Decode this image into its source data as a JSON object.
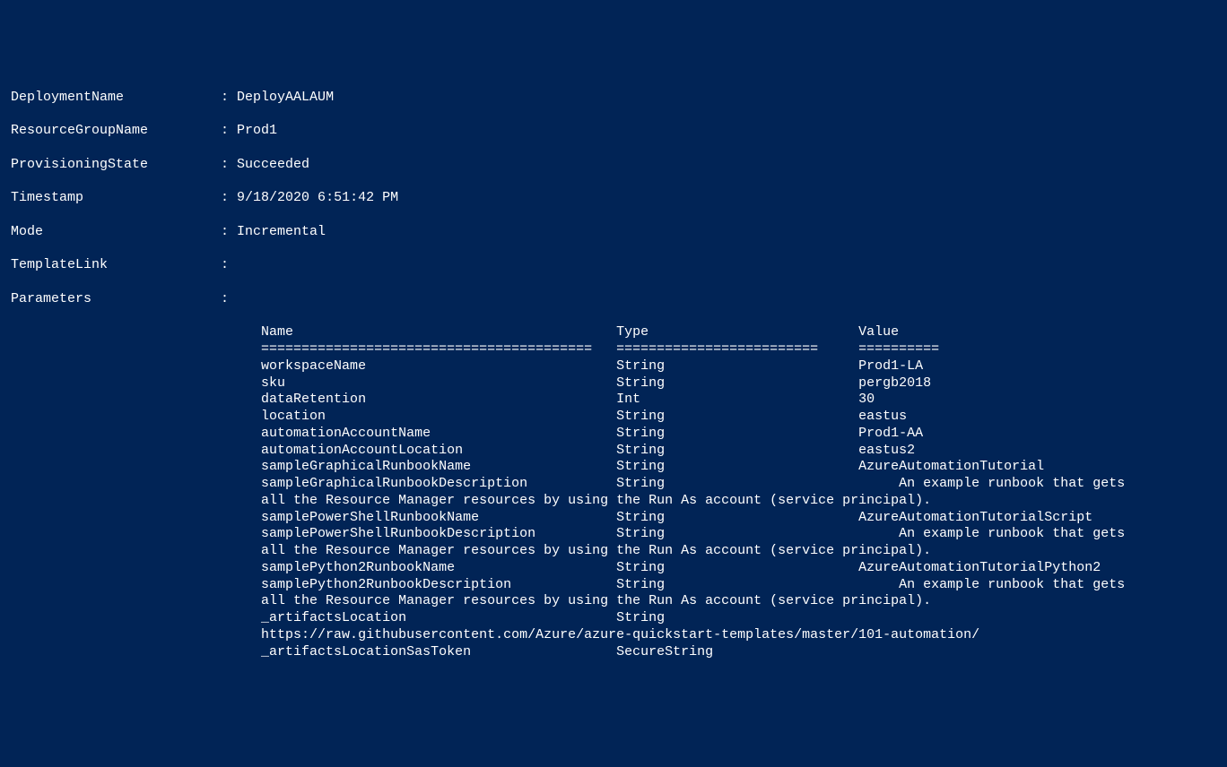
{
  "fields": {
    "deploymentName": {
      "label": "DeploymentName",
      "value": "DeployAALAUM"
    },
    "resourceGroupName": {
      "label": "ResourceGroupName",
      "value": "Prod1"
    },
    "provisioningState": {
      "label": "ProvisioningState",
      "value": "Succeeded"
    },
    "timestamp": {
      "label": "Timestamp",
      "value": "9/18/2020 6:51:42 PM"
    },
    "mode": {
      "label": "Mode",
      "value": "Incremental"
    },
    "templateLink": {
      "label": "TemplateLink",
      "value": ""
    },
    "parameters": {
      "label": "Parameters",
      "value": ""
    }
  },
  "paramsTable": {
    "header": {
      "name": "Name",
      "type": "Type",
      "value": "Value"
    },
    "divider": {
      "name": "=========================================",
      "type": "=========================",
      "value": "=========="
    },
    "rows": [
      {
        "name": "workspaceName",
        "type": "String",
        "value": "Prod1-LA",
        "wrap": ""
      },
      {
        "name": "sku",
        "type": "String",
        "value": "pergb2018",
        "wrap": ""
      },
      {
        "name": "dataRetention",
        "type": "Int",
        "value": "30",
        "wrap": ""
      },
      {
        "name": "location",
        "type": "String",
        "value": "eastus",
        "wrap": ""
      },
      {
        "name": "automationAccountName",
        "type": "String",
        "value": "Prod1-AA",
        "wrap": ""
      },
      {
        "name": "automationAccountLocation",
        "type": "String",
        "value": "eastus2",
        "wrap": ""
      },
      {
        "name": "sampleGraphicalRunbookName",
        "type": "String",
        "value": "AzureAutomationTutorial",
        "wrap": ""
      },
      {
        "name": "sampleGraphicalRunbookDescription",
        "type": "String",
        "value": "     An example runbook that gets",
        "wrap": "all the Resource Manager resources by using the Run As account (service principal)."
      },
      {
        "name": "samplePowerShellRunbookName",
        "type": "String",
        "value": "AzureAutomationTutorialScript",
        "wrap": ""
      },
      {
        "name": "samplePowerShellRunbookDescription",
        "type": "String",
        "value": "     An example runbook that gets",
        "wrap": "all the Resource Manager resources by using the Run As account (service principal)."
      },
      {
        "name": "samplePython2RunbookName",
        "type": "String",
        "value": "AzureAutomationTutorialPython2",
        "wrap": ""
      },
      {
        "name": "samplePython2RunbookDescription",
        "type": "String",
        "value": "     An example runbook that gets",
        "wrap": "all the Resource Manager resources by using the Run As account (service principal)."
      },
      {
        "name": "_artifactsLocation",
        "type": "String",
        "value": "",
        "wrap": "https://raw.githubusercontent.com/Azure/azure-quickstart-templates/master/101-automation/"
      },
      {
        "name": "_artifactsLocationSasToken",
        "type": "SecureString",
        "value": "",
        "wrap": ""
      }
    ]
  }
}
